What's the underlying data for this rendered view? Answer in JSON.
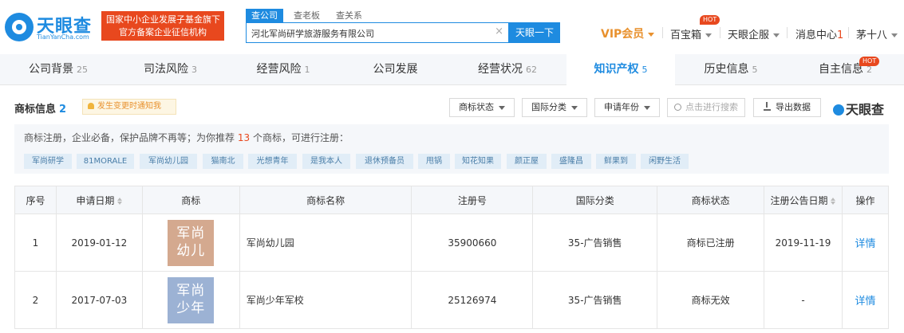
{
  "header": {
    "logo_text": "天眼查",
    "logo_sub": "TianYanCha.com",
    "banner_line1": "国家中小企业发展子基金旗下",
    "banner_line2": "官方备案企业征信机构",
    "search_tabs": [
      "查公司",
      "查老板",
      "查关系"
    ],
    "search_value": "河北军尚研学旅游服务有限公司",
    "search_button": "天眼一下",
    "vip": "VIP会员",
    "treasure": "百宝箱",
    "hot": "HOT",
    "enterprise": "天眼企服",
    "messages": "消息中心",
    "message_count": "1",
    "user": "茅十八"
  },
  "tabs": [
    {
      "label": "公司背景",
      "count": "25"
    },
    {
      "label": "司法风险",
      "count": "3"
    },
    {
      "label": "经营风险",
      "count": "1"
    },
    {
      "label": "公司发展",
      "count": ""
    },
    {
      "label": "经营状况",
      "count": "62"
    },
    {
      "label": "知识产权",
      "count": "5"
    },
    {
      "label": "历史信息",
      "count": "5"
    },
    {
      "label": "自主信息",
      "count": "2"
    }
  ],
  "section": {
    "title": "商标信息",
    "count": "2",
    "notify": "发生变更时通知我",
    "filters": [
      "商标状态",
      "国际分类",
      "申请年份"
    ],
    "search_placeholder": "点击进行搜索",
    "export": "导出数据",
    "brand": "天眼查"
  },
  "recommend": {
    "text_before": "商标注册，企业必备，保护品牌不再等；为你推荐",
    "number": "13",
    "text_after": "个商标，可进行注册：",
    "chips": [
      "军尚研学",
      "81MORALE",
      "军尚幼儿园",
      "猫南北",
      "光想青年",
      "是我本人",
      "退休预备员",
      "甩锅",
      "知花知果",
      "颜正屋",
      "盛隆昌",
      "鲜果到",
      "闲野生活"
    ]
  },
  "table": {
    "headers": [
      "序号",
      "申请日期",
      "商标",
      "商标名称",
      "注册号",
      "国际分类",
      "商标状态",
      "注册公告日期",
      "操作"
    ],
    "rows": [
      {
        "index": "1",
        "date": "2019-01-12",
        "logo_line1": "军尚",
        "logo_line2": "幼儿",
        "logo_color": "#d4a98f",
        "name": "军尚幼儿园",
        "reg_no": "35900660",
        "class": "35-广告销售",
        "status": "商标已注册",
        "pub_date": "2019-11-19",
        "action": "详情"
      },
      {
        "index": "2",
        "date": "2017-07-03",
        "logo_line1": "军尚",
        "logo_line2": "少年",
        "logo_color": "#9cb2d4",
        "name": "军尚少年军校",
        "reg_no": "25126974",
        "class": "35-广告销售",
        "status": "商标无效",
        "pub_date": "-",
        "action": "详情"
      }
    ]
  },
  "colors": {
    "accent": "#1e8be0",
    "alert": "#e8481e",
    "vip": "#e8912e"
  }
}
